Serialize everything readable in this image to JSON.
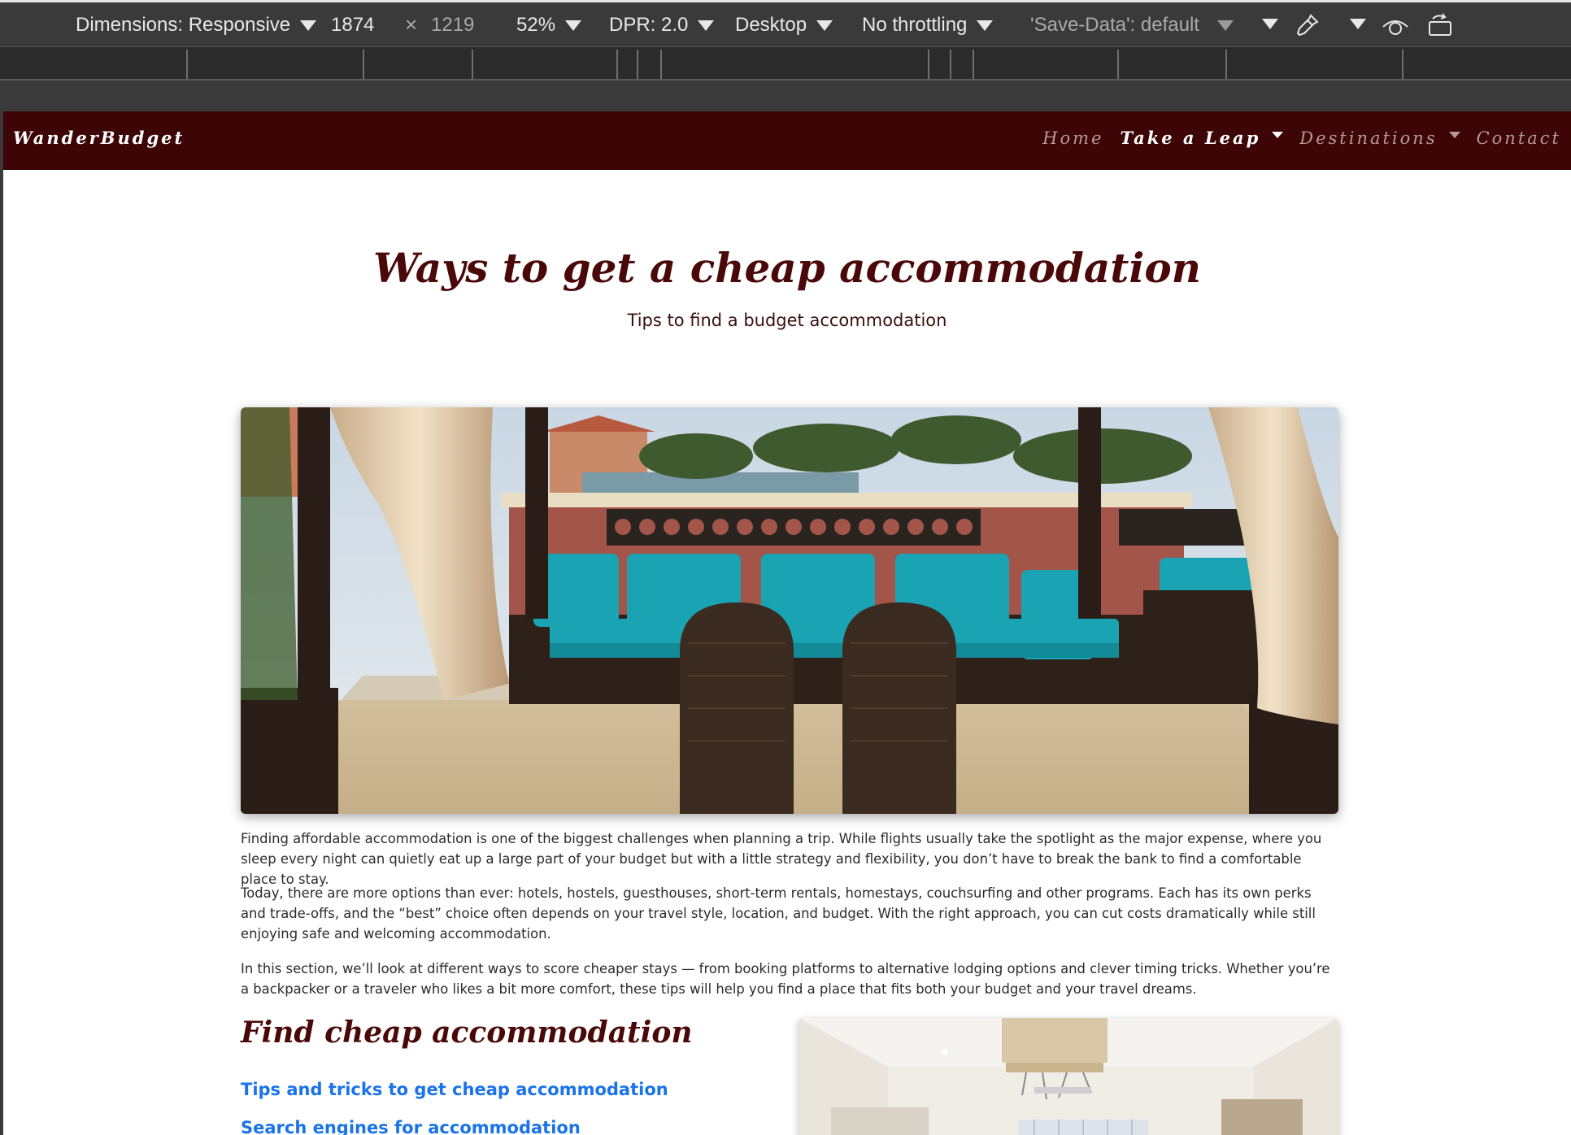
{
  "devtools": {
    "dimensions_label": "Dimensions: Responsive",
    "width_value": "1874",
    "times_symbol": "×",
    "height_value": "1219",
    "zoom": "52%",
    "dpr": "DPR: 2.0",
    "device_type": "Desktop",
    "throttling": "No throttling",
    "save_data": "'Save-Data': default",
    "icons": [
      "chevron-down-icon",
      "eyedropper-icon",
      "vision-icon",
      "rotate-icon"
    ]
  },
  "site": {
    "brand": "WanderBudget",
    "nav": {
      "home": "Home",
      "take_a_leap": "Take a Leap",
      "destinations": "Destinations",
      "contact": "Contact"
    },
    "hero": {
      "title": "Ways to get a cheap accommodation",
      "subtitle": "Tips to find a budget accommodation"
    },
    "paragraphs": {
      "p1": "Finding affordable accommodation is one of the biggest challenges when planning a trip. While flights usually take the spotlight as the major expense, where you sleep every night can quietly eat up a large part of your budget but with a little strategy and flexibility, you don’t have to break the bank to find a comfortable place to stay.",
      "p2": "Today, there are more options than ever: hotels, hostels, guesthouses, short-term rentals, homestays, couchsurfing and other programs. Each has its own perks and trade-offs, and the “best” choice often depends on your travel style, location, and budget. With the right approach, you can cut costs dramatically while still enjoying safe and welcoming accommodation.",
      "p3": "In this section, we’ll look at different ways to score cheaper stays — from booking platforms to alternative lodging options and clever timing tricks. Whether you’re a backpacker or a traveler who likes a bit more comfort, these tips will help you find a place that fits both your budget and your travel dreams."
    },
    "section": {
      "title": "Find cheap accommodation",
      "links": [
        "Tips and tricks to get cheap accommodation",
        "Search engines for accommodation"
      ]
    },
    "colors": {
      "navbar_bg": "#3d0505",
      "heading": "#4a0808",
      "link": "#1a73e8"
    }
  }
}
